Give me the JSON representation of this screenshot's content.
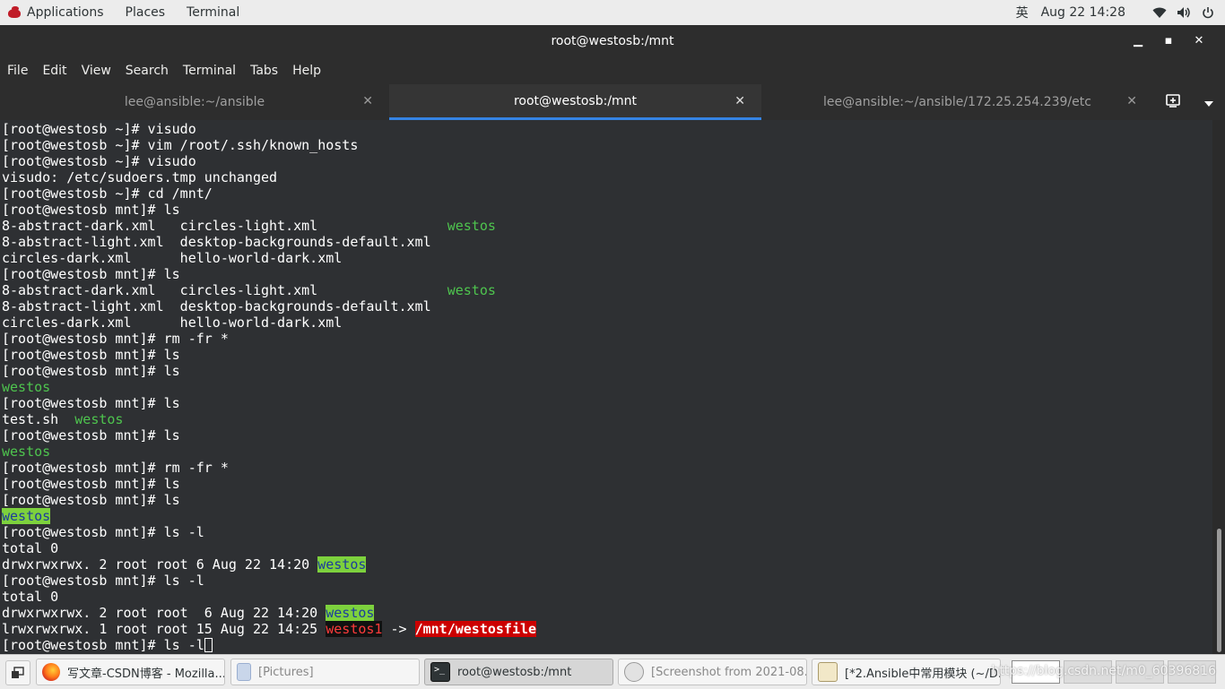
{
  "topbar": {
    "applications": "Applications",
    "places": "Places",
    "terminal": "Terminal",
    "input_method": "英",
    "clock": "Aug 22  14:28",
    "tray_icons": [
      "wifi-icon",
      "volume-icon",
      "power-icon"
    ]
  },
  "window": {
    "title": "root@westosb:/mnt",
    "controls": [
      "minimize",
      "maximize",
      "close"
    ]
  },
  "menubar": [
    "File",
    "Edit",
    "View",
    "Search",
    "Terminal",
    "Tabs",
    "Help"
  ],
  "tabs": [
    {
      "label": "lee@ansible:~/ansible",
      "active": false
    },
    {
      "label": "root@westosb:/mnt",
      "active": true
    },
    {
      "label": "lee@ansible:~/ansible/172.25.254.239/etc",
      "active": false
    }
  ],
  "terminal_lines": [
    [
      {
        "t": "[root@westosb ~]# visudo"
      }
    ],
    [
      {
        "t": "[root@westosb ~]# vim /root/.ssh/known_hosts"
      }
    ],
    [
      {
        "t": "[root@westosb ~]# visudo"
      }
    ],
    [
      {
        "t": "visudo: /etc/sudoers.tmp unchanged"
      }
    ],
    [
      {
        "t": "[root@westosb ~]# cd /mnt/"
      }
    ],
    [
      {
        "t": "[root@westosb mnt]# ls"
      }
    ],
    [
      {
        "t": "8-abstract-dark.xml   circles-light.xml                "
      },
      {
        "t": "westos",
        "c": "g"
      }
    ],
    [
      {
        "t": "8-abstract-light.xml  desktop-backgrounds-default.xml"
      }
    ],
    [
      {
        "t": "circles-dark.xml      hello-world-dark.xml"
      }
    ],
    [
      {
        "t": "[root@westosb mnt]# ls"
      }
    ],
    [
      {
        "t": "8-abstract-dark.xml   circles-light.xml                "
      },
      {
        "t": "westos",
        "c": "g"
      }
    ],
    [
      {
        "t": "8-abstract-light.xml  desktop-backgrounds-default.xml"
      }
    ],
    [
      {
        "t": "circles-dark.xml      hello-world-dark.xml"
      }
    ],
    [
      {
        "t": "[root@westosb mnt]# rm -fr *"
      }
    ],
    [
      {
        "t": "[root@westosb mnt]# ls"
      }
    ],
    [
      {
        "t": "[root@westosb mnt]# ls"
      }
    ],
    [
      {
        "t": "westos",
        "c": "g"
      }
    ],
    [
      {
        "t": "[root@westosb mnt]# ls"
      }
    ],
    [
      {
        "t": "test.sh  "
      },
      {
        "t": "westos",
        "c": "g"
      }
    ],
    [
      {
        "t": "[root@westosb mnt]# ls"
      }
    ],
    [
      {
        "t": "westos",
        "c": "g"
      }
    ],
    [
      {
        "t": "[root@westosb mnt]# rm -fr *"
      }
    ],
    [
      {
        "t": "[root@westosb mnt]# ls"
      }
    ],
    [
      {
        "t": "[root@westosb mnt]# ls"
      }
    ],
    [
      {
        "t": "westos",
        "c": "hl"
      }
    ],
    [
      {
        "t": "[root@westosb mnt]# ls -l"
      }
    ],
    [
      {
        "t": "total 0"
      }
    ],
    [
      {
        "t": "drwxrwxrwx. 2 root root 6 Aug 22 14:20 "
      },
      {
        "t": "westos",
        "c": "hl"
      }
    ],
    [
      {
        "t": "[root@westosb mnt]# ls -l"
      }
    ],
    [
      {
        "t": "total 0"
      }
    ],
    [
      {
        "t": "drwxrwxrwx. 2 root root  6 Aug 22 14:20 "
      },
      {
        "t": "westos",
        "c": "hl"
      }
    ],
    [
      {
        "t": "lrwxrwxrwx. 1 root root 15 Aug 22 14:25 "
      },
      {
        "t": "westos1",
        "c": "bl"
      },
      {
        "t": " -> "
      },
      {
        "t": "/mnt/westosfile",
        "c": "rd"
      }
    ],
    [
      {
        "t": "[root@westosb mnt]# ls -l"
      },
      {
        "t": "",
        "c": "cursor"
      }
    ]
  ],
  "taskbar": {
    "items": [
      {
        "label": "写文章-CSDN博客 - Mozilla...",
        "icon": "firefox-icon",
        "active": false
      },
      {
        "label": "[Pictures]",
        "icon": "folder-icon",
        "active": false
      },
      {
        "label": "root@westosb:/mnt",
        "icon": "terminal-icon",
        "active": true
      },
      {
        "label": "[Screenshot from 2021-08...",
        "icon": "screenshot-icon",
        "active": false
      },
      {
        "label": "[*2.Ansible中常用模块 (~/D...",
        "icon": "text-editor-icon",
        "active": false
      }
    ],
    "watermark": "https://blog.csdn.net/m0_60396816"
  }
}
